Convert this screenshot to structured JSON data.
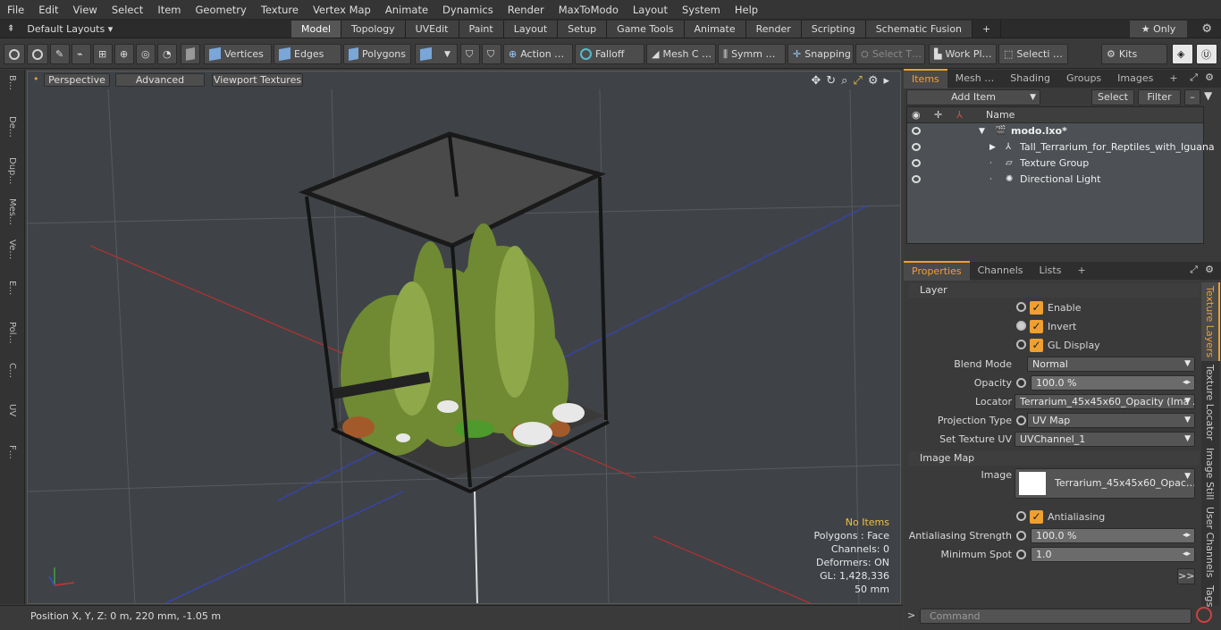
{
  "menu": [
    "File",
    "Edit",
    "View",
    "Select",
    "Item",
    "Geometry",
    "Texture",
    "Vertex Map",
    "Animate",
    "Dynamics",
    "Render",
    "MaxToModo",
    "Layout",
    "System",
    "Help"
  ],
  "layout_selector": "Default Layouts ▾",
  "tabs": [
    "Model",
    "Topology",
    "UVEdit",
    "Paint",
    "Layout",
    "Setup",
    "Game Tools",
    "Animate",
    "Render",
    "Scripting",
    "Schematic Fusion"
  ],
  "tab_add": "+",
  "only_btn": "★  Only",
  "toolbar": {
    "vertices": "Vertices",
    "edges": "Edges",
    "polygons": "Polygons",
    "action": "Action  …",
    "falloff": "Falloff",
    "mesh": "Mesh C …",
    "symm": "Symm …",
    "snapping": "Snapping",
    "select_t": "Select T…",
    "work_pl": "Work Pl…",
    "selecti": "Selecti …",
    "kits": "Kits"
  },
  "left_strip": [
    "B…",
    "De…",
    "Dup…",
    "Mes…",
    "Ve…",
    "E…",
    "Pol…",
    "C…",
    "UV",
    "F…"
  ],
  "viewport": {
    "perspective": "Perspective",
    "advanced": "Advanced",
    "viewport_textures": "Viewport Textures"
  },
  "vp_info": {
    "no_items": "No Items",
    "polygons": "Polygons : Face",
    "channels": "Channels: 0",
    "deformers": "Deformers: ON",
    "gl": "GL: 1,428,336",
    "scale": "50 mm"
  },
  "status": {
    "position": "Position X, Y, Z:   0 m, 220 mm, -1.05 m"
  },
  "items_tabs": [
    "Items",
    "Mesh …",
    "Shading",
    "Groups",
    "Images"
  ],
  "items_add": "+",
  "add_item": "Add Item",
  "select_btn": "Select",
  "filter_btn": "Filter",
  "tree_header": "Name",
  "tree": [
    {
      "label": "modo.lxo*",
      "indent": 0
    },
    {
      "label": "Tall_Terrarium_for_Reptiles_with_Iguana",
      "indent": 1
    },
    {
      "label": "Texture Group",
      "indent": 1
    },
    {
      "label": "Directional Light",
      "indent": 1
    }
  ],
  "prop_tabs": [
    "Properties",
    "Channels",
    "Lists"
  ],
  "prop_add": "+",
  "props": {
    "layer_section": "Layer",
    "enable": "Enable",
    "invert": "Invert",
    "gl_display": "GL Display",
    "blend_mode_lbl": "Blend Mode",
    "blend_mode": "Normal",
    "opacity_lbl": "Opacity",
    "opacity": "100.0 %",
    "locator_lbl": "Locator",
    "locator": "Terrarium_45x45x60_Opacity (Ima …",
    "projection_lbl": "Projection Type",
    "projection": "UV Map",
    "set_uv_lbl": "Set Texture UV",
    "set_uv": "UVChannel_1",
    "image_map_section": "Image Map",
    "image_lbl": "Image",
    "image": "Terrarium_45x45x60_Opac…",
    "antialiasing": "Antialiasing",
    "aa_strength_lbl": "Antialiasing Strength",
    "aa_strength": "100.0 %",
    "min_spot_lbl": "Minimum Spot",
    "min_spot": "1.0",
    "more": ">>"
  },
  "vtabs": [
    "Texture Layers",
    "Texture Locator",
    "Image Still",
    "User Channels",
    "Tags"
  ],
  "command_placeholder": "Command",
  "check_mark": "✓",
  "colors": {
    "accent": "#f0a030",
    "x_axis": "#d03030",
    "y_axis": "#40a040",
    "z_axis": "#3050d0"
  }
}
